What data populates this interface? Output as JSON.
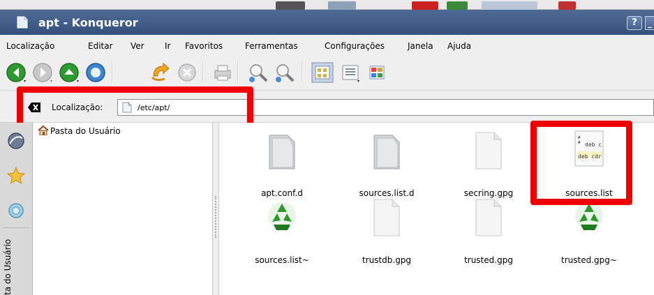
{
  "window": {
    "title": "apt - Konqueror",
    "help_button": "?",
    "minimize_button": "_"
  },
  "menubar": {
    "items": [
      "Localização",
      "Editar",
      "Ver",
      "Ir",
      "Favoritos",
      "Ferramentas",
      "Configurações",
      "Janela",
      "Ajuda"
    ]
  },
  "toolbar": {
    "icons": [
      "back-icon",
      "forward-icon",
      "up-icon",
      "home-icon",
      "reload-icon",
      "stop-icon",
      "print-icon",
      "zoom-in-icon",
      "zoom-out-icon",
      "icon-view-icon",
      "detail-view-icon",
      "split-view-icon"
    ]
  },
  "location": {
    "label": "Localização:",
    "value": "/etc/apt/"
  },
  "sidebar": {
    "tabs": [
      "globe-icon",
      "star-icon",
      "history-icon"
    ],
    "vertical_label": "ta do Usuário"
  },
  "navigation": {
    "home_label": "Pasta do Usuário"
  },
  "files": [
    {
      "name": "apt.conf.d",
      "type": "folder"
    },
    {
      "name": "sources.list.d",
      "type": "folder"
    },
    {
      "name": "secring.gpg",
      "type": "file"
    },
    {
      "name": "sources.list",
      "type": "text"
    },
    {
      "name": "sources.list~",
      "type": "recycle"
    },
    {
      "name": "trustdb.gpg",
      "type": "file"
    },
    {
      "name": "trusted.gpg",
      "type": "file"
    },
    {
      "name": "trusted.gpg~",
      "type": "recycle"
    }
  ],
  "text_preview": {
    "line1": "deb c",
    "line2": "deb cdr"
  },
  "colors": {
    "highlight": "#ee0000",
    "titlebar": "#3d5986",
    "toolbar_bg": "#efefef"
  }
}
